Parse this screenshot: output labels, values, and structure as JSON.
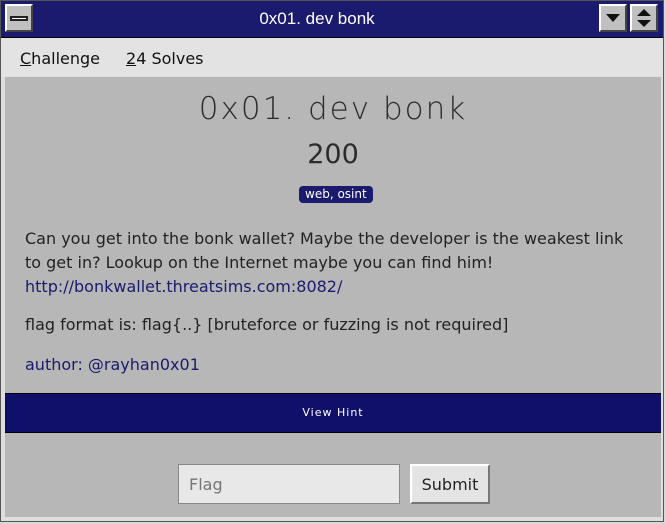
{
  "window": {
    "title": "0x01. dev bonk"
  },
  "menu": {
    "challenge": {
      "first": "C",
      "rest": "hallenge"
    },
    "solves": {
      "first": "2",
      "rest": "4 Solves"
    }
  },
  "challenge": {
    "name": "0x01. dev bonk",
    "points": "200",
    "tags": "web, osint",
    "description": "Can you get into the bonk wallet? Maybe the developer is the weakest link to get in? Lookup on the Internet maybe you can find him!",
    "url": "http://bonkwallet.threatsims.com:8082/",
    "flag_format": "flag format is: flag{..} [bruteforce or fuzzing is not required]",
    "author": "author: @rayhan0x01"
  },
  "hint": {
    "label": "View Hint"
  },
  "submission": {
    "placeholder": "Flag",
    "submit_label": "Submit"
  },
  "colors": {
    "accent": "#1a1a6e",
    "panel": "#b7b7b7"
  }
}
